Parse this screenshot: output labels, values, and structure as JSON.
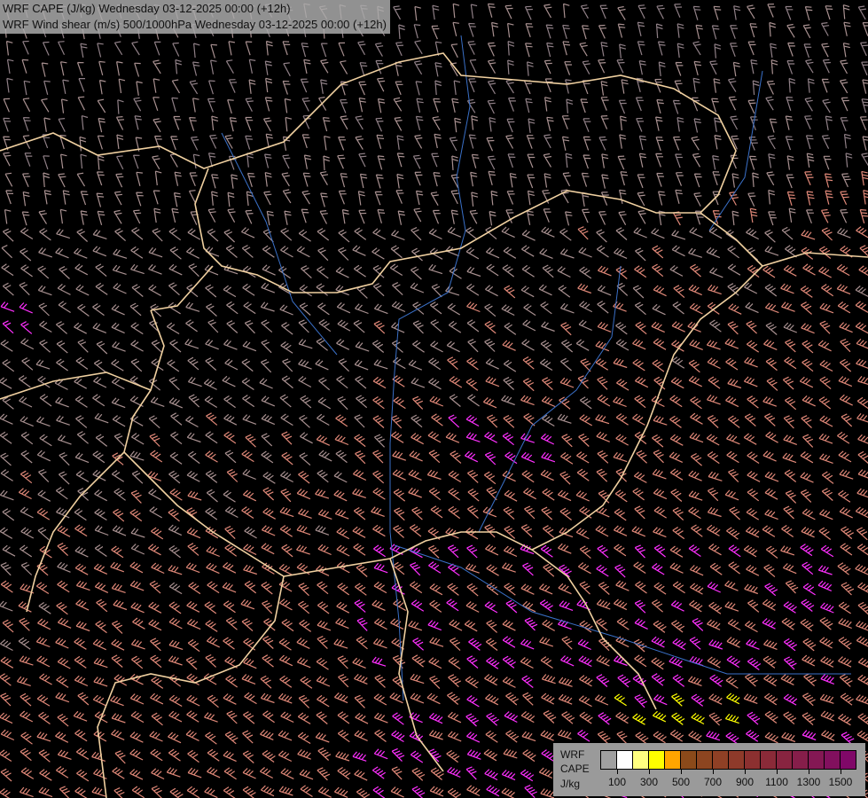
{
  "title": {
    "line1": "WRF CAPE (J/kg) Wednesday 03-12-2025 00:00 (+12h)",
    "line2": "WRF Wind shear (m/s) 500/1000hPa Wednesday 03-12-2025 00:00 (+12h)"
  },
  "legend": {
    "label1": "WRF",
    "label2": "CAPE",
    "unit": "J/kg",
    "colors": [
      "#a0a0a0",
      "#ffffff",
      "#ffff80",
      "#ffff00",
      "#ffa500",
      "#8b4a1a",
      "#8d4520",
      "#8f4025",
      "#8e3a2a",
      "#8c3030",
      "#8a2a38",
      "#882440",
      "#861e4a",
      "#841854",
      "#82105e",
      "#800868"
    ],
    "ticks": [
      "100",
      "300",
      "500",
      "700",
      "900",
      "1100",
      "1300",
      "1500"
    ]
  },
  "colors": {
    "border": "#f0d0a0",
    "river": "#3a70c8",
    "barb_low": "#a89090",
    "barb_mid": "#e08878",
    "barb_high": "#ff30ff",
    "barb_max": "#ffff00"
  }
}
